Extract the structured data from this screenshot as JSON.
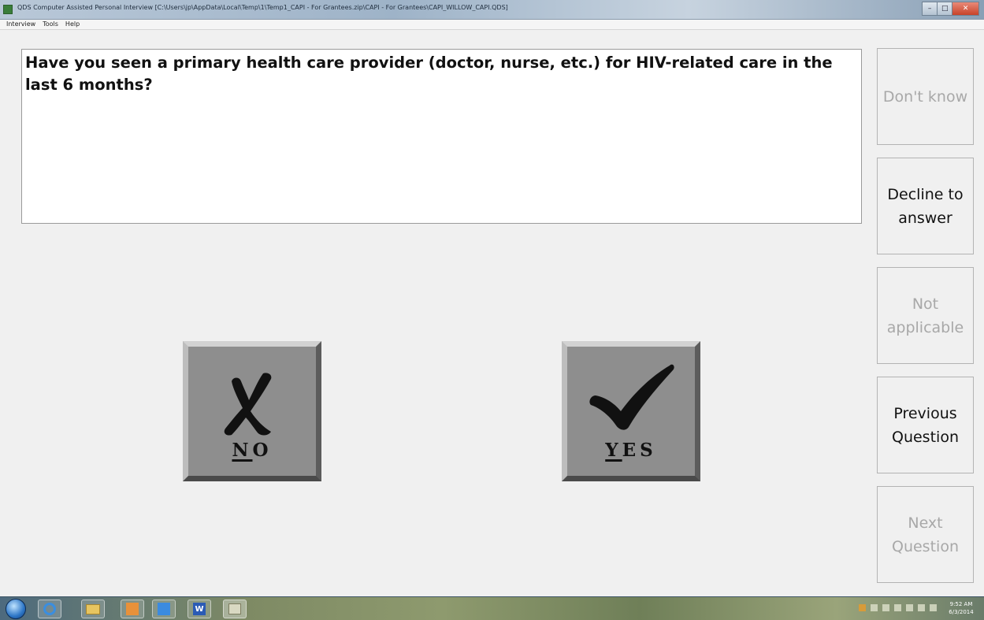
{
  "window": {
    "title": "QDS Computer Assisted Personal Interview [C:\\Users\\jp\\AppData\\Local\\Temp\\1\\Temp1_CAPI - For Grantees.zip\\CAPI - For Grantees\\CAPI_WILLOW_CAPI.QDS]",
    "controls": {
      "minimize": "–",
      "maximize": "□",
      "close": "✕"
    }
  },
  "menu": {
    "items": [
      "Interview",
      "Tools",
      "Help"
    ]
  },
  "question": {
    "text": "Have you seen a primary health care provider (doctor, nurse, etc.) for HIV-related care in the last 6 months?"
  },
  "answers": {
    "no": {
      "hotkey": "N",
      "rest": "O",
      "icon": "x-mark-icon"
    },
    "yes": {
      "hotkey": "Y",
      "rest": "ES",
      "icon": "checkmark-icon"
    }
  },
  "side_buttons": {
    "dont_know": {
      "label": "Don't know",
      "enabled": false
    },
    "decline": {
      "label": "Decline to answer",
      "enabled": true
    },
    "not_applicable": {
      "label": "Not applicable",
      "enabled": false
    },
    "previous": {
      "label": "Previous Question",
      "enabled": true
    },
    "next": {
      "label": "Next Question",
      "enabled": false
    }
  },
  "taskbar": {
    "apps": [
      "internet-explorer-icon",
      "folder-icon",
      "outlook-icon",
      "lync-icon",
      "word-icon",
      "qds-app-icon"
    ],
    "word_letter": "W",
    "clock": {
      "time": "9:52 AM",
      "date": "6/3/2014"
    }
  },
  "colors": {
    "disabled_text": "#a8a8a8",
    "answer_button": "#8e8e8e",
    "background": "#f0f0f0"
  }
}
